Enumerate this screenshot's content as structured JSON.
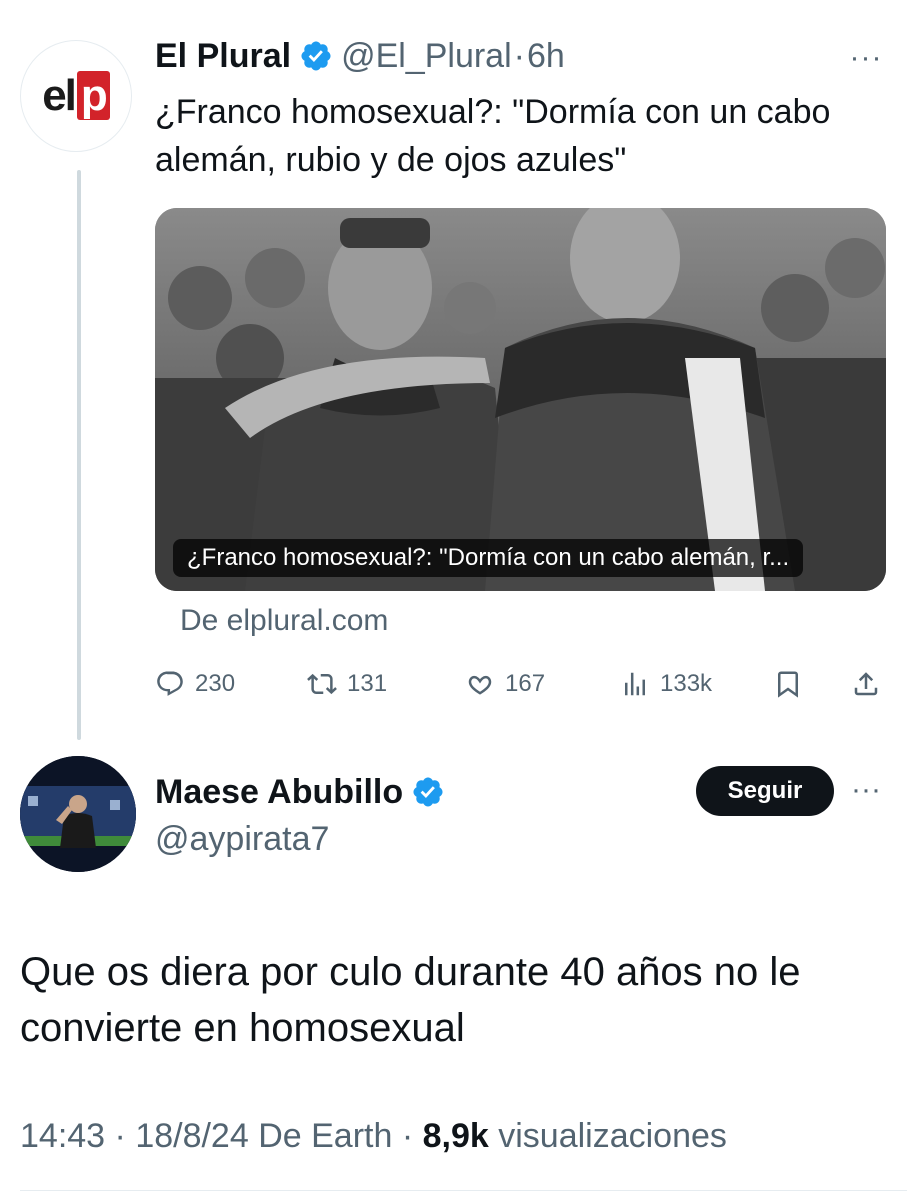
{
  "tweet1": {
    "display_name": "El Plural",
    "handle": "@El_Plural",
    "separator": "·",
    "time": "6h",
    "more": "···",
    "avatar_logo": {
      "el": "el",
      "p": "p"
    },
    "text": "¿Franco homosexual?: \"Dormía con un cabo alemán, rubio y de ojos azules\"",
    "card": {
      "caption": "¿Franco homosexual?: \"Dormía con un cabo alemán, r...",
      "source": "De elplural.com"
    },
    "actions": {
      "replies": "230",
      "retweets": "131",
      "likes": "167",
      "views": "133k"
    }
  },
  "tweet2": {
    "display_name": "Maese Abubillo",
    "handle": "@aypirata7",
    "follow_label": "Seguir",
    "more": "···",
    "text": "Que os diera por culo durante 40 años no le convierte en homosexual",
    "meta": {
      "time": "14:43",
      "sep1": " · ",
      "date": "18/8/24",
      "via": " De Earth",
      "sep2": " · ",
      "views_count": "8,9k",
      "views_label": " visualizaciones"
    }
  },
  "colors": {
    "verified": "#1d9bf0",
    "secondary_text": "#536471",
    "primary_text": "#0f1419",
    "brand_red": "#d2232a"
  },
  "icons": [
    "verified-badge-icon",
    "more-icon",
    "reply-icon",
    "retweet-icon",
    "like-icon",
    "views-icon",
    "bookmark-icon",
    "share-icon"
  ]
}
